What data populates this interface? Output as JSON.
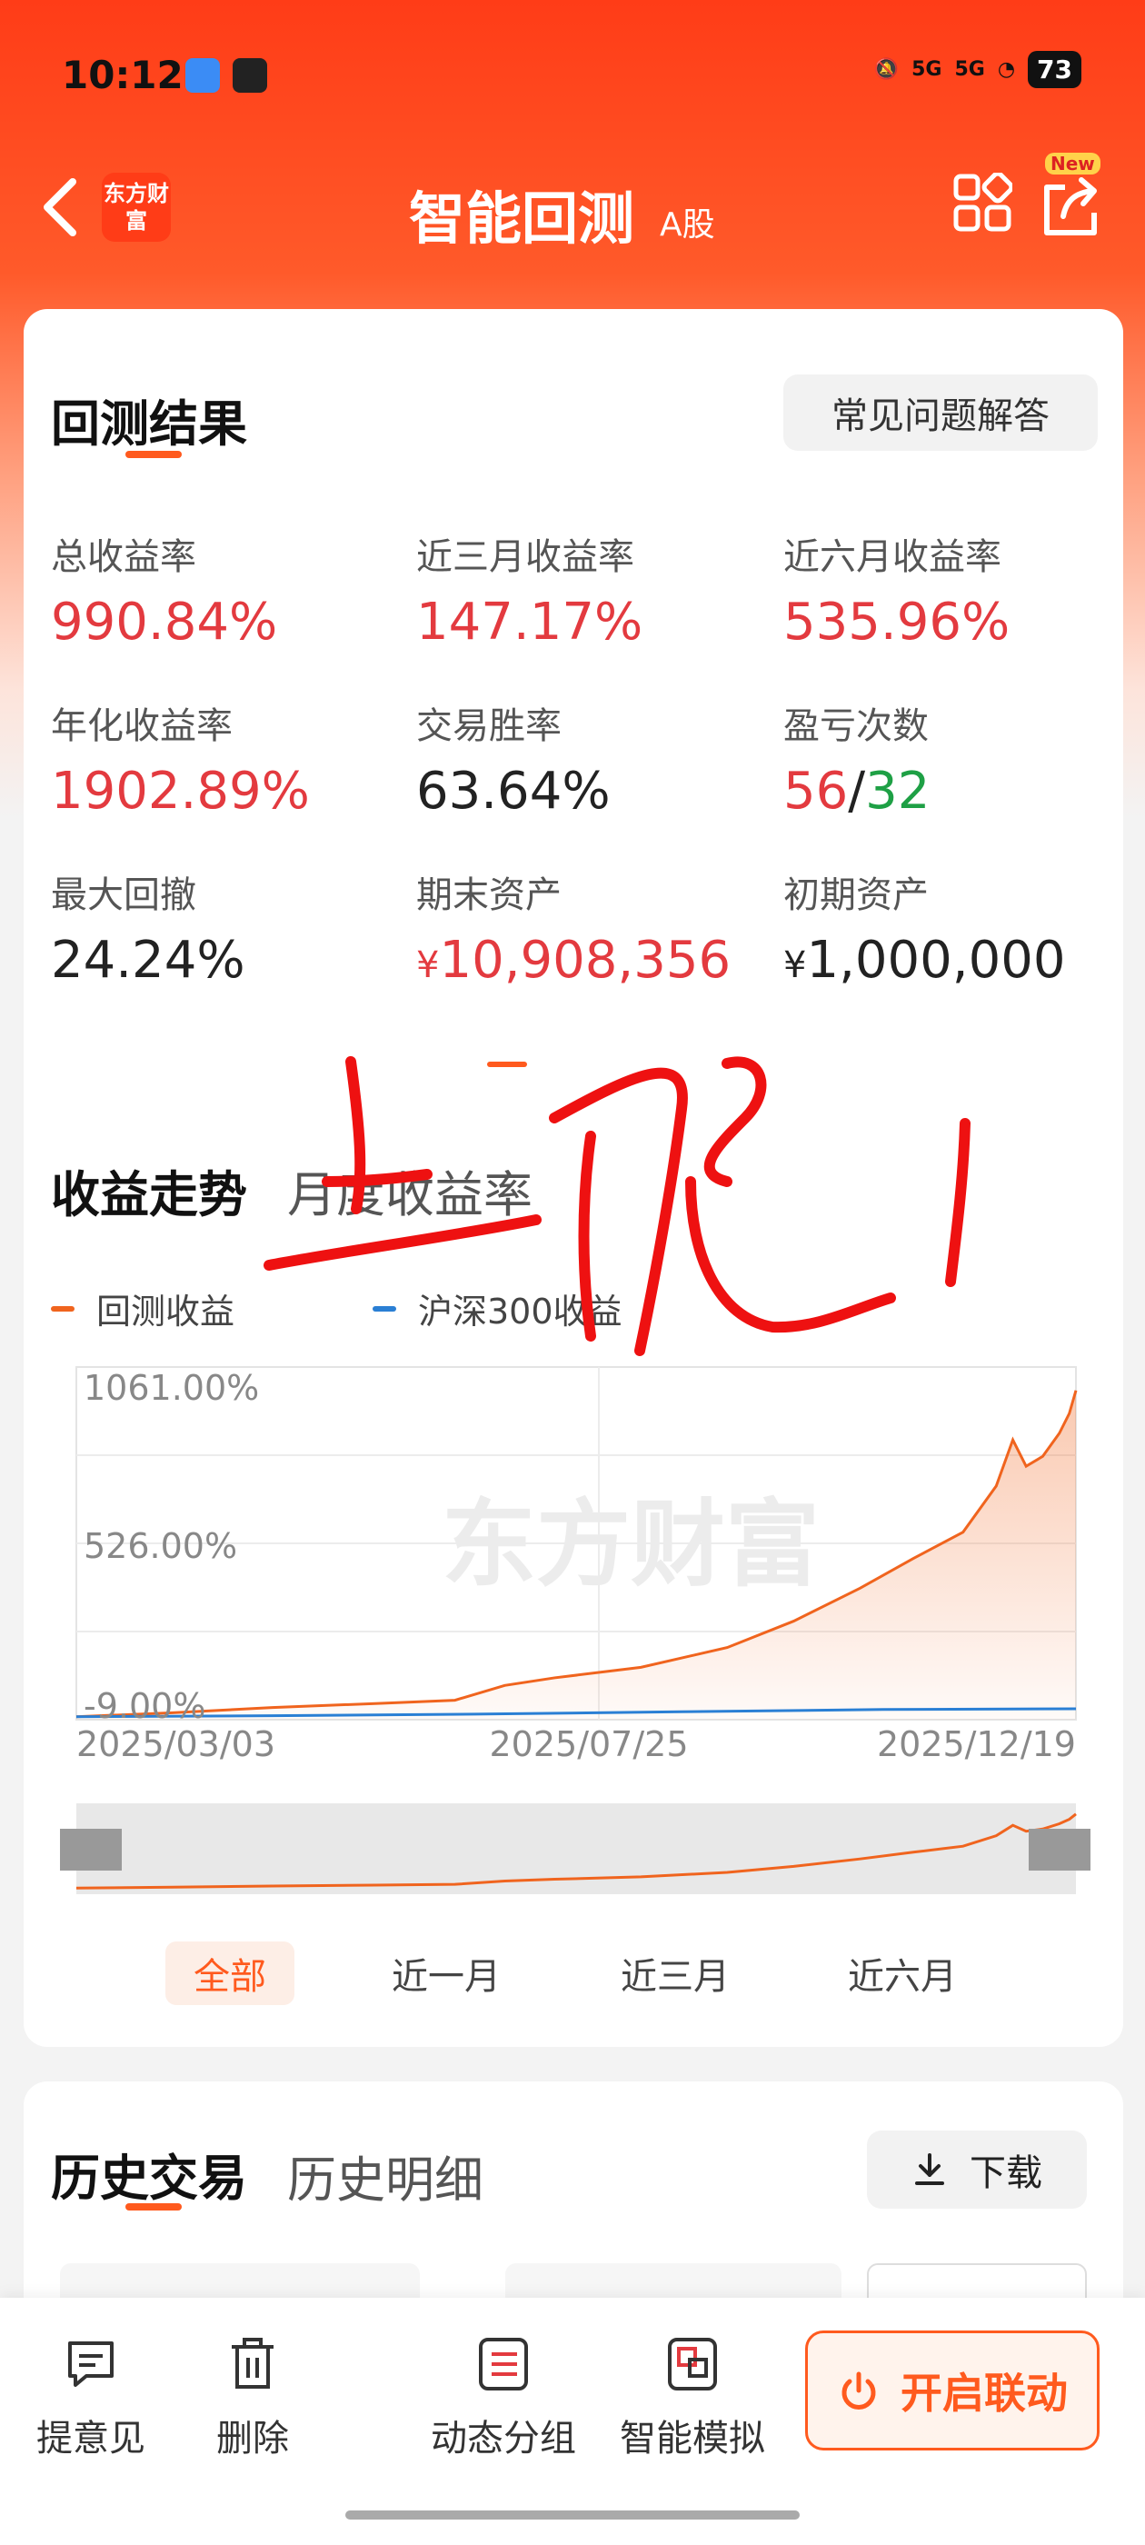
{
  "status": {
    "time": "10:12",
    "signal1": "5G",
    "signal2": "5G",
    "battery": "73"
  },
  "nav": {
    "brand": "东方财富",
    "title": "智能回测",
    "subtitle": "A股",
    "new_badge": "New"
  },
  "results": {
    "title": "回测结果",
    "faq_label": "常见问题解答",
    "metrics": [
      {
        "label": "总收益率",
        "value": "990.84%"
      },
      {
        "label": "近三月收益率",
        "value": "147.17%"
      },
      {
        "label": "近六月收益率",
        "value": "535.96%"
      },
      {
        "label": "年化收益率",
        "value": "1902.89%"
      },
      {
        "label": "交易胜率",
        "value": "63.64%"
      },
      {
        "label": "盈亏次数",
        "win": "56",
        "sep": "/",
        "loss": "32"
      },
      {
        "label": "最大回撤",
        "value": "24.24%"
      },
      {
        "label": "期末资产",
        "currency": "¥",
        "value": "10,908,356"
      },
      {
        "label": "初期资产",
        "currency": "¥",
        "value": "1,000,000"
      }
    ]
  },
  "trend": {
    "tab_active": "收益走势",
    "tab_other": "月度收益率",
    "watermark": "东方财富",
    "range_buttons": [
      "全部",
      "近一月",
      "近三月",
      "近六月"
    ],
    "active_range": "全部"
  },
  "chart_data": {
    "type": "line",
    "ylim": [
      -9.0,
      1061.0
    ],
    "yticks": [
      "1061.00%",
      "526.00%",
      "-9.00%"
    ],
    "xticks": [
      "2025/03/03",
      "2025/07/25",
      "2025/12/19"
    ],
    "x_range": [
      "2025/03/03",
      "2025/12/29"
    ],
    "series": [
      {
        "name": "回测收益",
        "color": "#f0641e",
        "points": [
          [
            "2025/03/03",
            0
          ],
          [
            "2025/04/01",
            12
          ],
          [
            "2025/05/01",
            28
          ],
          [
            "2025/06/01",
            40
          ],
          [
            "2025/06/25",
            50
          ],
          [
            "2025/07/10",
            95
          ],
          [
            "2025/07/25",
            118
          ],
          [
            "2025/08/20",
            150
          ],
          [
            "2025/09/15",
            210
          ],
          [
            "2025/10/05",
            290
          ],
          [
            "2025/10/25",
            390
          ],
          [
            "2025/11/10",
            480
          ],
          [
            "2025/11/25",
            560
          ],
          [
            "2025/12/05",
            700
          ],
          [
            "2025/12/10",
            840
          ],
          [
            "2025/12/14",
            760
          ],
          [
            "2025/12/19",
            790
          ],
          [
            "2025/12/24",
            860
          ],
          [
            "2025/12/27",
            920
          ],
          [
            "2025/12/29",
            990
          ]
        ]
      },
      {
        "name": "沪深300收益",
        "color": "#2a7fd4",
        "points": [
          [
            "2025/03/03",
            0
          ],
          [
            "2025/05/01",
            3
          ],
          [
            "2025/07/01",
            8
          ],
          [
            "2025/09/01",
            15
          ],
          [
            "2025/11/01",
            22
          ],
          [
            "2025/12/29",
            24
          ]
        ]
      }
    ]
  },
  "history": {
    "title": "历史交易",
    "tab_other": "历史明细",
    "download_label": "下载"
  },
  "bottom_bar": {
    "items": [
      {
        "label": "提意见",
        "icon": "feedback-icon"
      },
      {
        "label": "删除",
        "icon": "trash-icon"
      },
      {
        "label": "动态分组",
        "icon": "list-icon"
      },
      {
        "label": "智能模拟",
        "icon": "simulate-icon"
      }
    ],
    "cta_label": "开启联动"
  }
}
